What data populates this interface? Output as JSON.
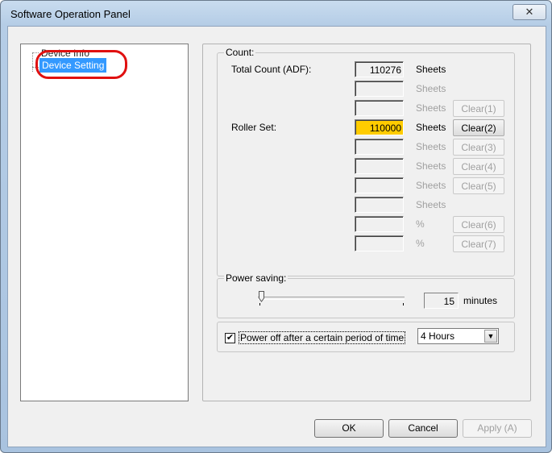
{
  "window": {
    "title": "Software Operation Panel",
    "close_glyph": "✕"
  },
  "tree": {
    "items": [
      {
        "label": "Device Info",
        "selected": false
      },
      {
        "label": "Device Setting",
        "selected": true
      }
    ]
  },
  "count": {
    "group_title": "Count:",
    "rows": [
      {
        "label": "Total Count (ADF):",
        "value": "110276",
        "unit": "Sheets",
        "unit_enabled": true,
        "button": null
      },
      {
        "label": "",
        "value": "",
        "unit": "Sheets",
        "unit_enabled": false,
        "button": null
      },
      {
        "label": "",
        "value": "",
        "unit": "Sheets",
        "unit_enabled": false,
        "button": {
          "label": "Clear(1)",
          "enabled": false
        }
      },
      {
        "label": "Roller Set:",
        "value": "110000",
        "unit": "Sheets",
        "unit_enabled": true,
        "button": {
          "label": "Clear(2)",
          "enabled": true
        },
        "highlight": true
      },
      {
        "label": "",
        "value": "",
        "unit": "Sheets",
        "unit_enabled": false,
        "button": {
          "label": "Clear(3)",
          "enabled": false
        }
      },
      {
        "label": "",
        "value": "",
        "unit": "Sheets",
        "unit_enabled": false,
        "button": {
          "label": "Clear(4)",
          "enabled": false
        }
      },
      {
        "label": "",
        "value": "",
        "unit": "Sheets",
        "unit_enabled": false,
        "button": {
          "label": "Clear(5)",
          "enabled": false
        }
      },
      {
        "label": "",
        "value": "",
        "unit": "Sheets",
        "unit_enabled": false,
        "button": null
      },
      {
        "label": "",
        "value": "",
        "unit": "%",
        "unit_enabled": false,
        "button": {
          "label": "Clear(6)",
          "enabled": false
        }
      },
      {
        "label": "",
        "value": "",
        "unit": "%",
        "unit_enabled": false,
        "button": {
          "label": "Clear(7)",
          "enabled": false
        }
      }
    ]
  },
  "power_saving": {
    "group_title": "Power saving:",
    "value": "15",
    "unit": "minutes",
    "slider_fraction": 0.02
  },
  "power_off": {
    "checked": true,
    "check_glyph": "✔",
    "label": "Power off after a certain period of time",
    "selected_option": "4 Hours",
    "arrow_glyph": "▼"
  },
  "buttons": {
    "ok": "OK",
    "cancel": "Cancel",
    "apply": "Apply (A)"
  },
  "colors": {
    "highlight": "#ffcc00",
    "selection": "#3399ff",
    "annotation": "#e01010"
  }
}
